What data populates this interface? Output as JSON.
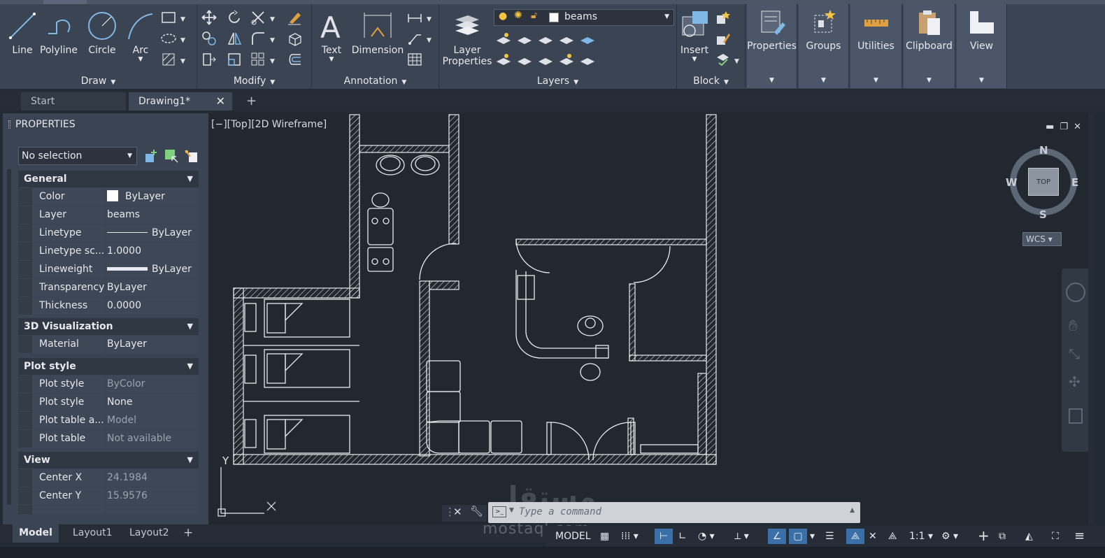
{
  "ribbon": {
    "panels": {
      "draw": {
        "title": "Draw",
        "tools": [
          "Line",
          "Polyline",
          "Circle",
          "Arc"
        ]
      },
      "modify": {
        "title": "Modify"
      },
      "annotation": {
        "title": "Annotation",
        "tools": [
          "Text",
          "Dimension"
        ]
      },
      "layers": {
        "title": "Layers",
        "layer_properties_line1": "Layer",
        "layer_properties_line2": "Properties",
        "current_layer": "beams"
      },
      "block": {
        "title": "Block",
        "insert_label": "Insert"
      },
      "flyouts": [
        "Properties",
        "Groups",
        "Utilities",
        "Clipboard",
        "View"
      ]
    }
  },
  "tabs": {
    "start": "Start",
    "drawing": "Drawing1*",
    "close_glyph": "✕",
    "new_glyph": "+"
  },
  "properties": {
    "title": "PROPERTIES",
    "selection": "No selection",
    "sections": {
      "general": {
        "title": "General",
        "rows": [
          {
            "key": "Color",
            "value": "ByLayer"
          },
          {
            "key": "Layer",
            "value": "beams"
          },
          {
            "key": "Linetype",
            "value": "ByLayer"
          },
          {
            "key": "Linetype sc...",
            "value": "1.0000"
          },
          {
            "key": "Lineweight",
            "value": "ByLayer"
          },
          {
            "key": "Transparency",
            "value": "ByLayer"
          },
          {
            "key": "Thickness",
            "value": "0.0000"
          }
        ]
      },
      "viz3d": {
        "title": "3D Visualization",
        "rows": [
          {
            "key": "Material",
            "value": "ByLayer"
          }
        ]
      },
      "plot": {
        "title": "Plot style",
        "rows": [
          {
            "key": "Plot style",
            "value": "ByColor"
          },
          {
            "key": "Plot style ta...",
            "value": "None"
          },
          {
            "key": "Plot table a...",
            "value": "Model"
          },
          {
            "key": "Plot table ty...",
            "value": "Not available"
          }
        ]
      },
      "view": {
        "title": "View",
        "rows": [
          {
            "key": "Center X",
            "value": "24.1984"
          },
          {
            "key": "Center Y",
            "value": "15.9576"
          }
        ]
      }
    }
  },
  "viewport": {
    "label": "[−][Top][2D Wireframe]",
    "viewcube": {
      "north": "N",
      "south": "S",
      "east": "E",
      "west": "W",
      "face": "TOP",
      "ucs": "WCS"
    },
    "ucs_y": "Y"
  },
  "layout_tabs": {
    "model": "Model",
    "layout1": "Layout1",
    "layout2": "Layout2",
    "add": "+"
  },
  "command_line": {
    "placeholder": "Type a command"
  },
  "status_bar": {
    "model": "MODEL",
    "scale": "1:1"
  },
  "watermark": {
    "text": "mostaql.com",
    "arabic": "مستقل"
  },
  "colors": {
    "ribbon": "#3b4453",
    "canvas": "#212830",
    "accent": "#3b6fa8",
    "lines": "#e8ecf0"
  }
}
